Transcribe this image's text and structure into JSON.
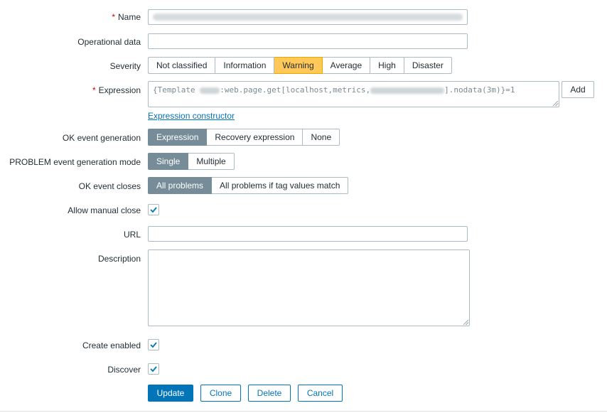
{
  "form": {
    "name": {
      "label": "Name",
      "value_blurred": true
    },
    "operational_data": {
      "label": "Operational data",
      "value": ""
    },
    "severity": {
      "label": "Severity",
      "options": [
        "Not classified",
        "Information",
        "Warning",
        "Average",
        "High",
        "Disaster"
      ],
      "selected": "Warning",
      "selected_color": "#ffc859"
    },
    "expression": {
      "label": "Expression",
      "prefix": "{Template ",
      "mid": ":web.page.get[localhost,metrics,",
      "suffix": "].nodata(3m)}=1",
      "add_label": "Add",
      "constructor_link": "Expression constructor"
    },
    "ok_event_generation": {
      "label": "OK event generation",
      "options": [
        "Expression",
        "Recovery expression",
        "None"
      ],
      "selected": "Expression"
    },
    "problem_mode": {
      "label": "PROBLEM event generation mode",
      "options": [
        "Single",
        "Multiple"
      ],
      "selected": "Single"
    },
    "ok_event_closes": {
      "label": "OK event closes",
      "options": [
        "All problems",
        "All problems if tag values match"
      ],
      "selected": "All problems"
    },
    "allow_manual_close": {
      "label": "Allow manual close",
      "checked": true
    },
    "url": {
      "label": "URL",
      "value": ""
    },
    "description": {
      "label": "Description",
      "value": ""
    },
    "create_enabled": {
      "label": "Create enabled",
      "checked": true
    },
    "discover": {
      "label": "Discover",
      "checked": true
    }
  },
  "actions": {
    "update": "Update",
    "clone": "Clone",
    "delete": "Delete",
    "cancel": "Cancel"
  },
  "icons": {
    "check": "check-icon"
  },
  "colors": {
    "accent": "#0275b8",
    "selected_seg": "#768d99",
    "required": "#d40000"
  }
}
